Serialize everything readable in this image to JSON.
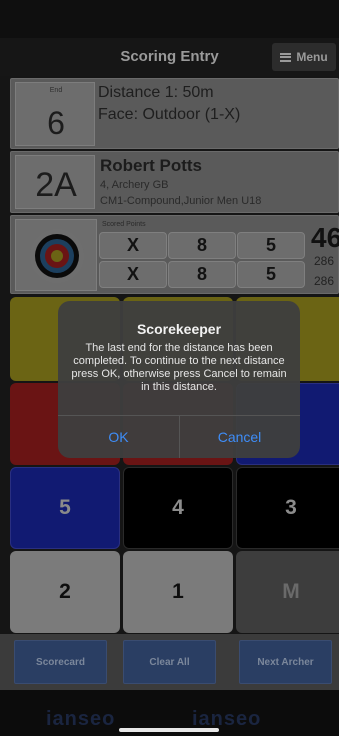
{
  "header": {
    "title": "Scoring Entry",
    "menu_label": "Menu"
  },
  "end": {
    "label": "End",
    "number": "6",
    "distance": "Distance 1: 50m",
    "face": "Face: Outdoor (1-X)"
  },
  "archer": {
    "target": "2A",
    "name": "Robert Potts",
    "club": "4, Archery GB",
    "classification": "CM1-Compound,Junior Men U18"
  },
  "scores": {
    "label": "Scored Points",
    "rows": [
      [
        "X",
        "8",
        "5"
      ],
      [
        "X",
        "8",
        "5"
      ]
    ],
    "total_big": "46",
    "totals": [
      "286",
      "286"
    ]
  },
  "keypad": {
    "row3": [
      "5",
      "4",
      "3"
    ],
    "row4": [
      "2",
      "1",
      "M"
    ]
  },
  "actions": {
    "scorecard": "Scorecard",
    "clear_all": "Clear All",
    "next_archer": "Next Archer"
  },
  "dialog": {
    "title": "Scorekeeper",
    "message": "The last end for the distance has been completed. To continue to the next distance press OK, otherwise press Cancel to remain in this distance.",
    "ok": "OK",
    "cancel": "Cancel"
  },
  "footer": {
    "logo": "ianseo"
  },
  "colors": {
    "accent": "#3e8df8",
    "button": "#2a3e63"
  },
  "icons": {
    "menu": "hamburger-icon",
    "target_face": "archery-target-icon"
  }
}
